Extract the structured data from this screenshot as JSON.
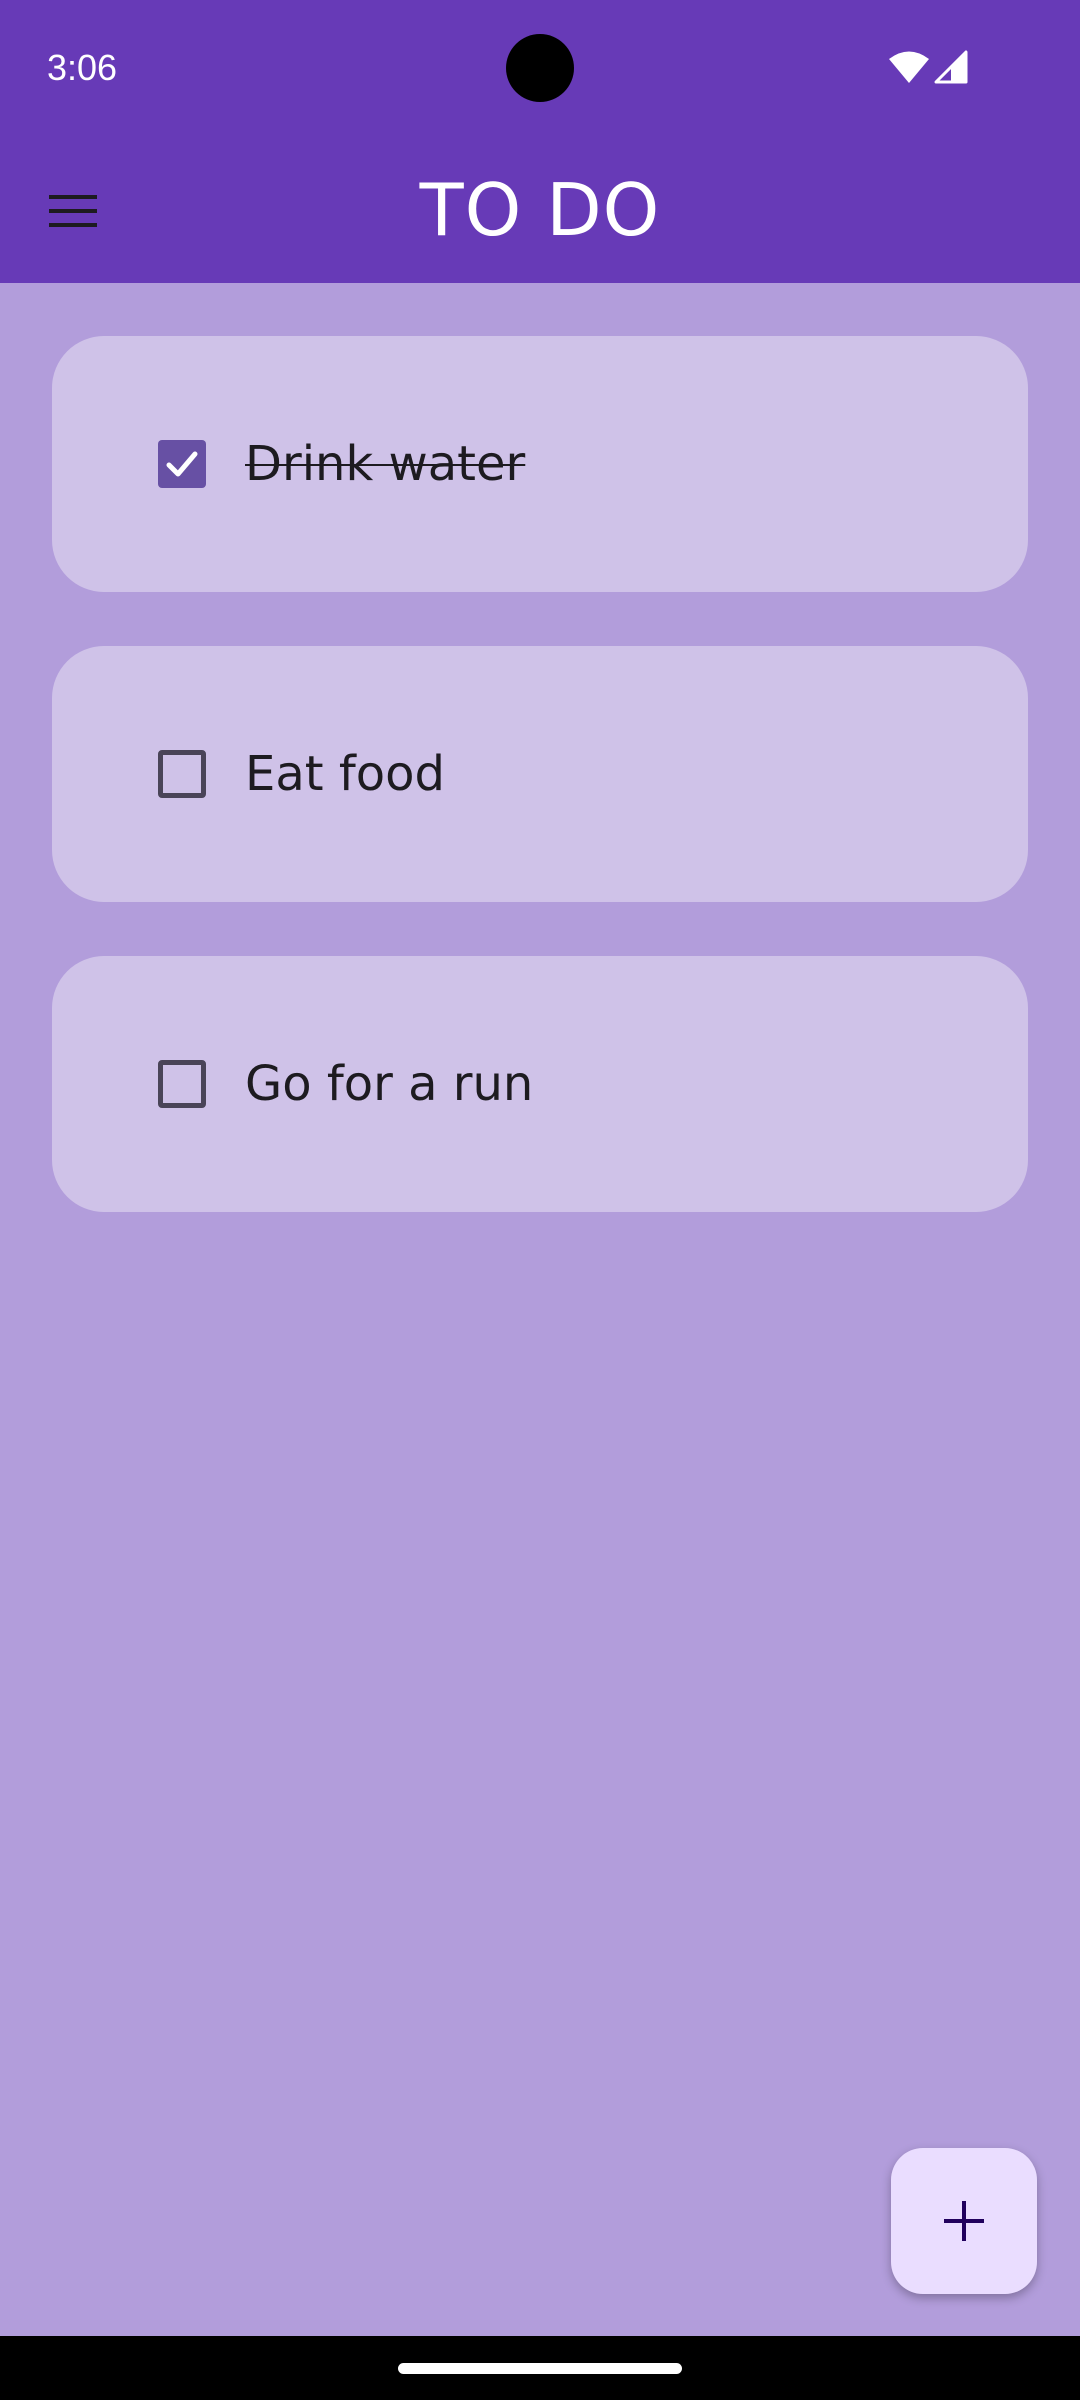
{
  "status_bar": {
    "time": "3:06",
    "icons": [
      "wifi-icon",
      "signal-icon"
    ],
    "color": "#673AB7"
  },
  "app_bar": {
    "title": "TO DO",
    "menu_icon": "menu-icon",
    "color": "#673AB7"
  },
  "tasks": [
    {
      "label": "Drink water",
      "checked": true
    },
    {
      "label": "Eat food",
      "checked": false
    },
    {
      "label": "Go for a run",
      "checked": false
    }
  ],
  "fab": {
    "icon": "plus-icon",
    "color": "#EADDFF"
  },
  "colors": {
    "background": "#B29DDB",
    "card": "#CFC2E8",
    "checkbox_checked": "#6750A4"
  }
}
